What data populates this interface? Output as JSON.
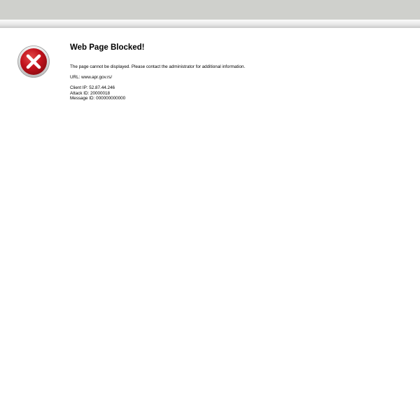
{
  "page": {
    "title": "Web Page Blocked!",
    "message": "The page cannot be displayed. Please contact the administrator for additional information.",
    "url_line": "URL: www.apr.gov.rs/",
    "client_ip_line": "Client IP: 52.87.44.246",
    "attack_id_line": "Attack ID: 20000018",
    "message_id_line": "Message ID: 000000000000"
  },
  "icon": {
    "name": "blocked-error-icon",
    "colors": {
      "ring": "#d7d7d7",
      "fill": "#c1121c",
      "symbol": "#ffffff"
    }
  }
}
